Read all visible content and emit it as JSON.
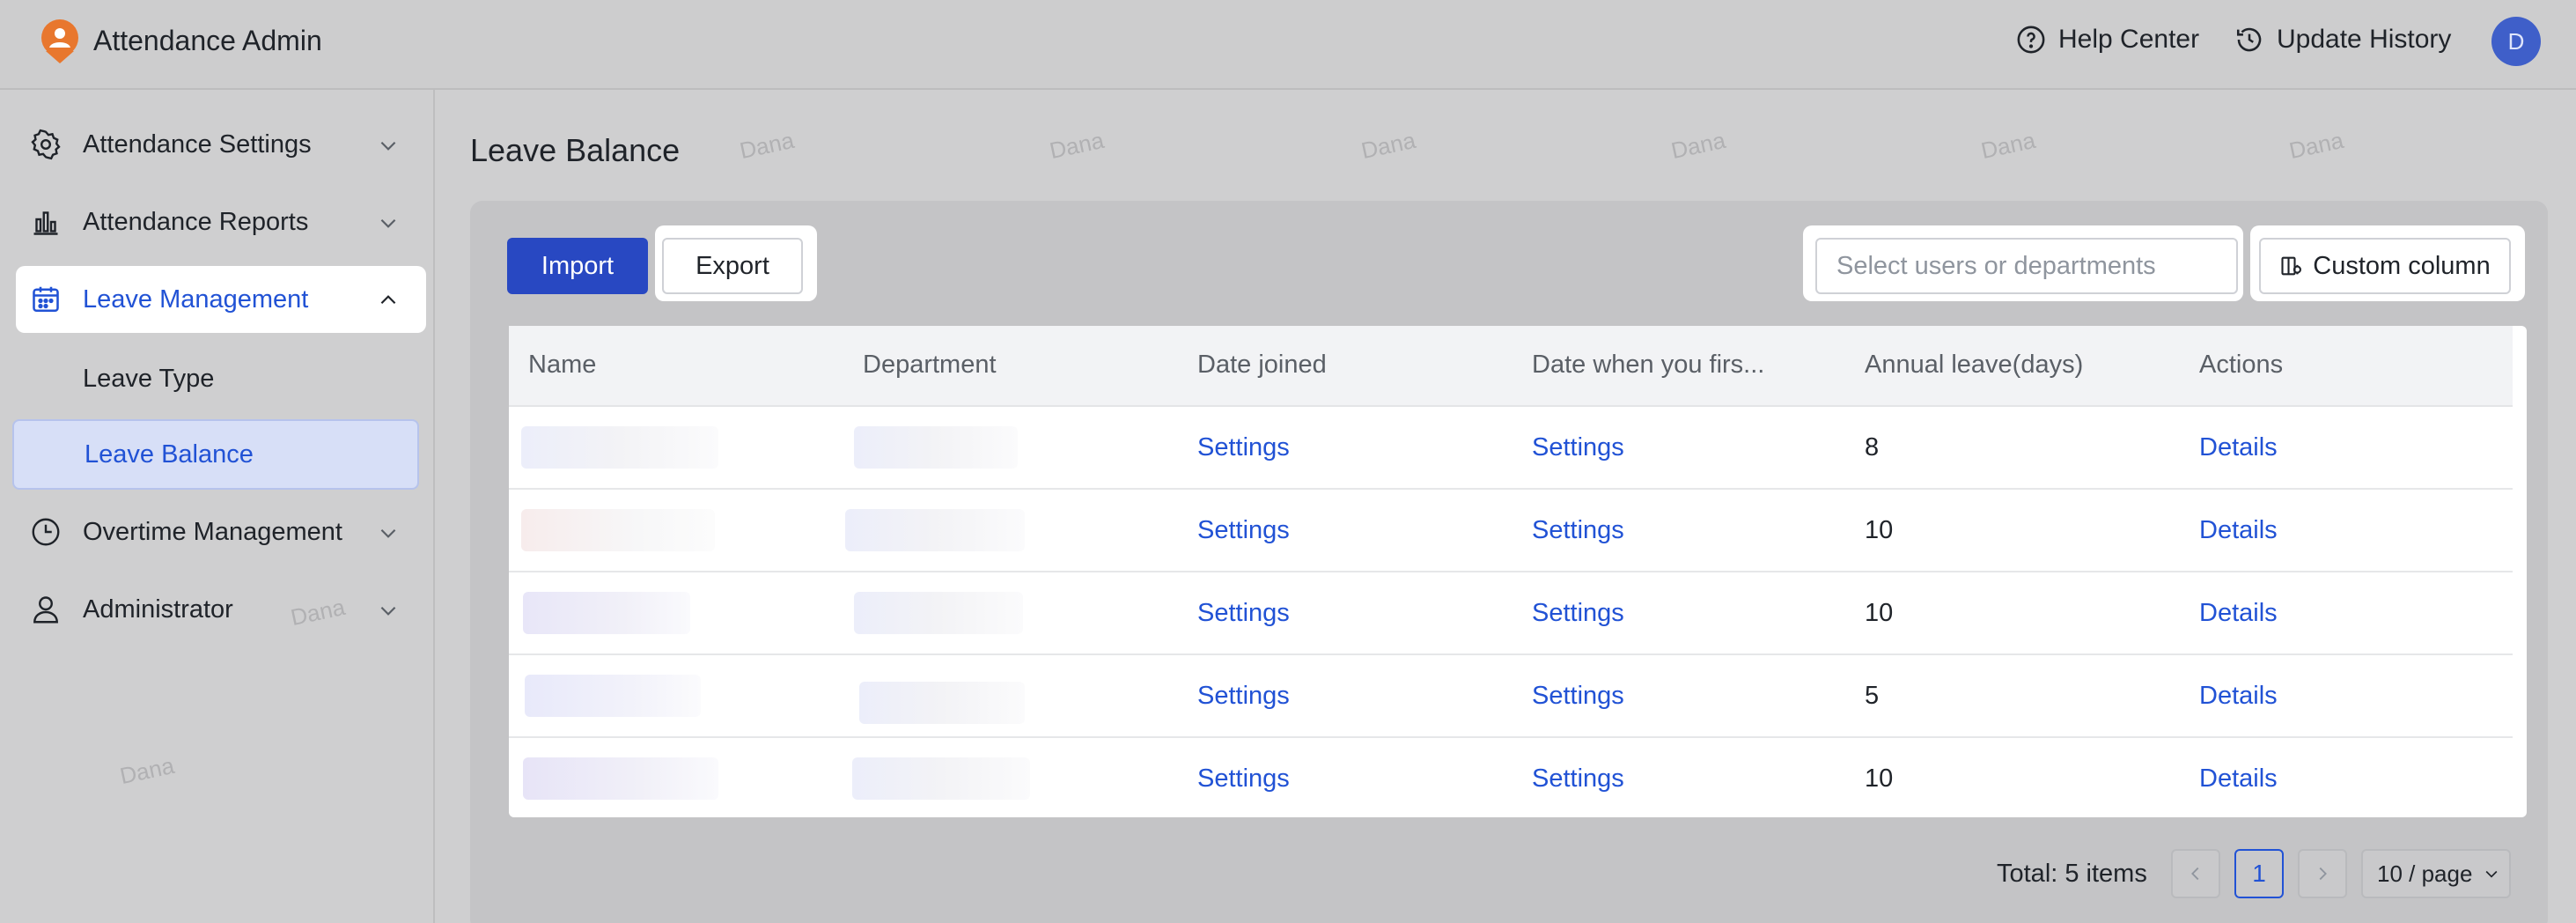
{
  "header": {
    "app_title": "Attendance Admin",
    "help_center": "Help Center",
    "update_history": "Update History",
    "avatar_initial": "D"
  },
  "sidebar": {
    "items": [
      {
        "label": "Attendance Settings",
        "icon": "gear-icon",
        "expanded": false
      },
      {
        "label": "Attendance Reports",
        "icon": "bar-chart-icon",
        "expanded": false
      },
      {
        "label": "Leave Management",
        "icon": "calendar-icon",
        "expanded": true
      },
      {
        "label": "Overtime Management",
        "icon": "clock-icon",
        "expanded": false
      },
      {
        "label": "Administrator",
        "icon": "user-icon",
        "expanded": false
      }
    ],
    "sub_items": [
      {
        "label": "Leave Type",
        "active": false
      },
      {
        "label": "Leave Balance",
        "active": true
      }
    ]
  },
  "main": {
    "page_title": "Leave Balance",
    "toolbar": {
      "import_label": "Import",
      "export_label": "Export",
      "select_placeholder": "Select users or departments",
      "custom_column_label": "Custom column"
    },
    "table": {
      "columns": [
        "Name",
        "Department",
        "Date joined",
        "Date when you firs...",
        "Annual leave(days)",
        "Actions"
      ],
      "rows": [
        {
          "date_joined": "Settings",
          "date_first": "Settings",
          "annual_leave": "8",
          "action": "Details"
        },
        {
          "date_joined": "Settings",
          "date_first": "Settings",
          "annual_leave": "10",
          "action": "Details"
        },
        {
          "date_joined": "Settings",
          "date_first": "Settings",
          "annual_leave": "10",
          "action": "Details"
        },
        {
          "date_joined": "Settings",
          "date_first": "Settings",
          "annual_leave": "5",
          "action": "Details"
        },
        {
          "date_joined": "Settings",
          "date_first": "Settings",
          "annual_leave": "10",
          "action": "Details"
        }
      ]
    },
    "pagination": {
      "total": "Total: 5 items",
      "current_page": "1",
      "page_size": "10 / page"
    }
  },
  "watermark": "Dana",
  "colors": {
    "accent": "#2152d5",
    "primary_button": "#2848c2",
    "avatar": "#3f5fc9",
    "logo": "#e8772e"
  }
}
